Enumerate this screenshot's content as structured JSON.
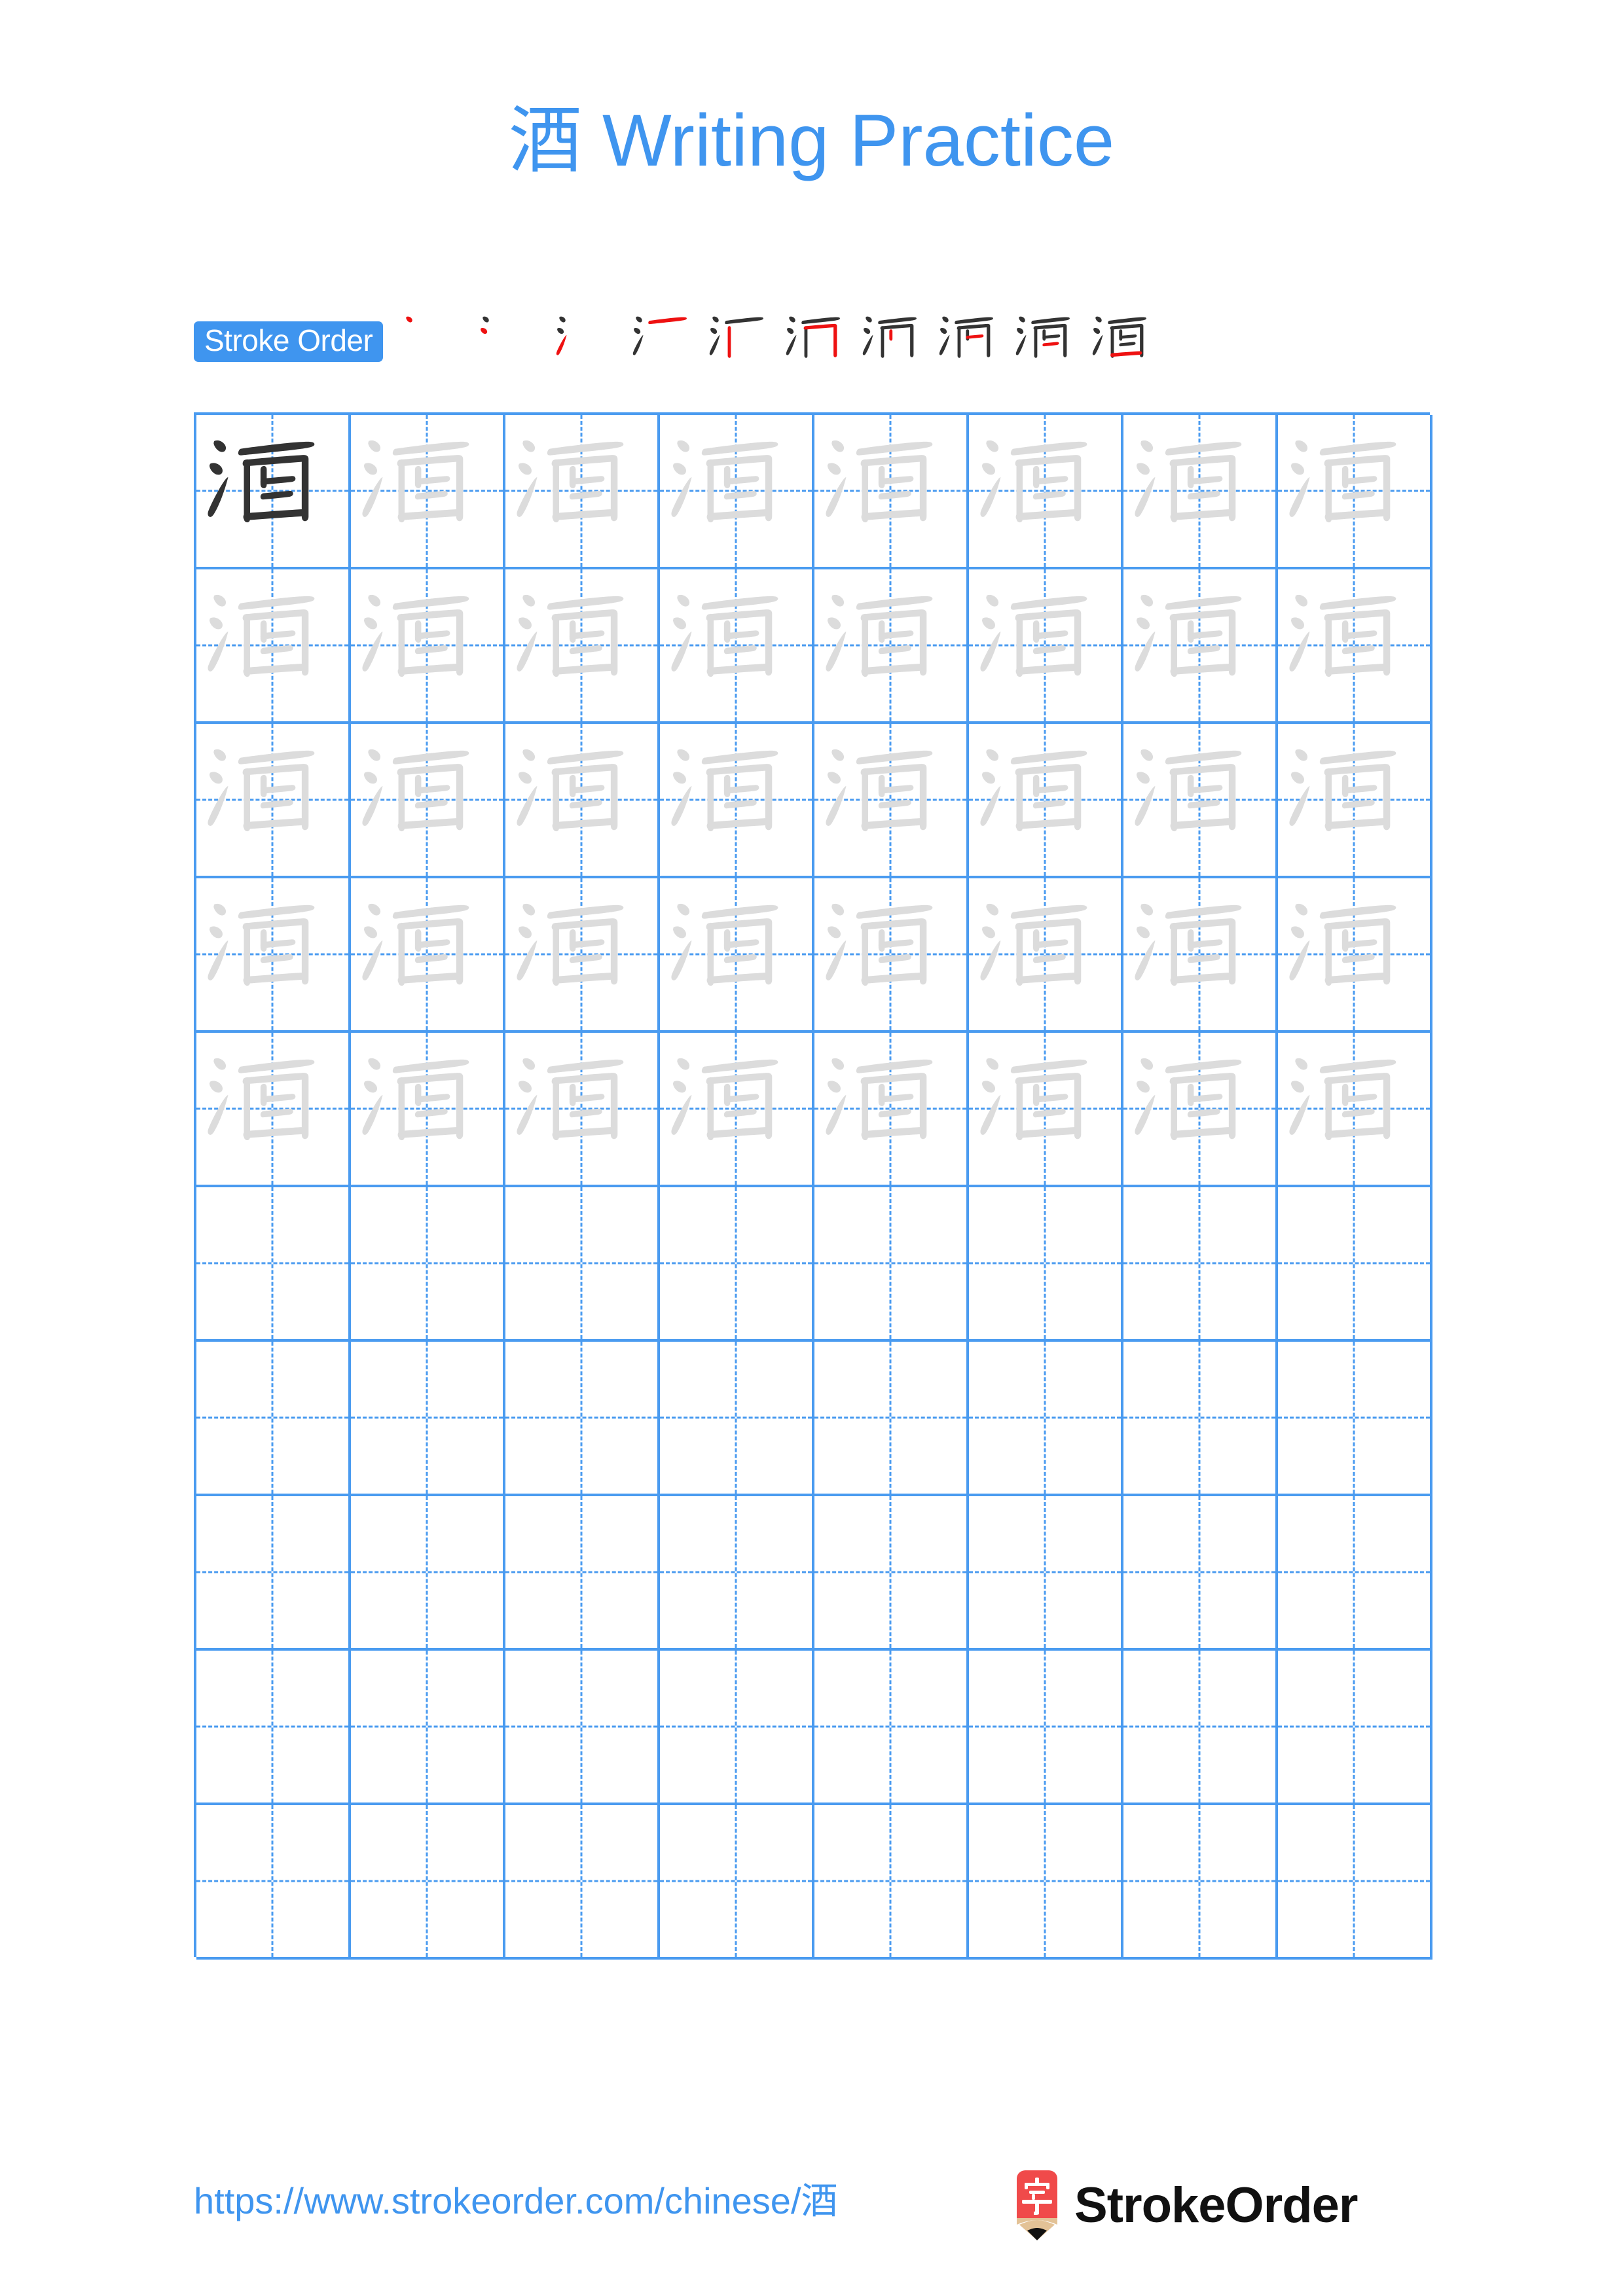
{
  "page": {
    "character": "酒",
    "title": "酒 Writing Practice",
    "accent_color": "#3f95ef",
    "grid_line_color": "#4a9bf0",
    "stroke_done_color": "#333333",
    "stroke_new_color": "#ee1111",
    "trace_glyph_color": "#dcdcdc",
    "model_glyph_color": "#333333"
  },
  "stroke_order": {
    "badge_label": "Stroke Order",
    "total_strokes": 10,
    "steps": [
      {
        "index": 1,
        "strokes_shown": 1,
        "new_stroke": 1
      },
      {
        "index": 2,
        "strokes_shown": 2,
        "new_stroke": 2
      },
      {
        "index": 3,
        "strokes_shown": 3,
        "new_stroke": 3
      },
      {
        "index": 4,
        "strokes_shown": 4,
        "new_stroke": 4
      },
      {
        "index": 5,
        "strokes_shown": 5,
        "new_stroke": 5
      },
      {
        "index": 6,
        "strokes_shown": 6,
        "new_stroke": 6
      },
      {
        "index": 7,
        "strokes_shown": 7,
        "new_stroke": 7
      },
      {
        "index": 8,
        "strokes_shown": 8,
        "new_stroke": 8
      },
      {
        "index": 9,
        "strokes_shown": 9,
        "new_stroke": 9
      },
      {
        "index": 10,
        "strokes_shown": 10,
        "new_stroke": 10
      }
    ]
  },
  "practice_grid": {
    "columns": 8,
    "rows": 10,
    "rows_data": [
      {
        "row": 1,
        "cells": [
          "model",
          "trace",
          "trace",
          "trace",
          "trace",
          "trace",
          "trace",
          "trace"
        ]
      },
      {
        "row": 2,
        "cells": [
          "trace",
          "trace",
          "trace",
          "trace",
          "trace",
          "trace",
          "trace",
          "trace"
        ]
      },
      {
        "row": 3,
        "cells": [
          "trace",
          "trace",
          "trace",
          "trace",
          "trace",
          "trace",
          "trace",
          "trace"
        ]
      },
      {
        "row": 4,
        "cells": [
          "trace",
          "trace",
          "trace",
          "trace",
          "trace",
          "trace",
          "trace",
          "trace"
        ]
      },
      {
        "row": 5,
        "cells": [
          "trace",
          "trace",
          "trace",
          "trace",
          "trace",
          "trace",
          "trace",
          "trace"
        ]
      },
      {
        "row": 6,
        "cells": [
          "empty",
          "empty",
          "empty",
          "empty",
          "empty",
          "empty",
          "empty",
          "empty"
        ]
      },
      {
        "row": 7,
        "cells": [
          "empty",
          "empty",
          "empty",
          "empty",
          "empty",
          "empty",
          "empty",
          "empty"
        ]
      },
      {
        "row": 8,
        "cells": [
          "empty",
          "empty",
          "empty",
          "empty",
          "empty",
          "empty",
          "empty",
          "empty"
        ]
      },
      {
        "row": 9,
        "cells": [
          "empty",
          "empty",
          "empty",
          "empty",
          "empty",
          "empty",
          "empty",
          "empty"
        ]
      },
      {
        "row": 10,
        "cells": [
          "empty",
          "empty",
          "empty",
          "empty",
          "empty",
          "empty",
          "empty",
          "empty"
        ]
      }
    ]
  },
  "footer": {
    "url": "https://www.strokeorder.com/chinese/酒",
    "logo_text": "StrokeOrder",
    "logo_character": "字",
    "logo_body_color": "#f04a4a",
    "logo_wood_color": "#e3c296",
    "logo_tip_color": "#111111"
  }
}
